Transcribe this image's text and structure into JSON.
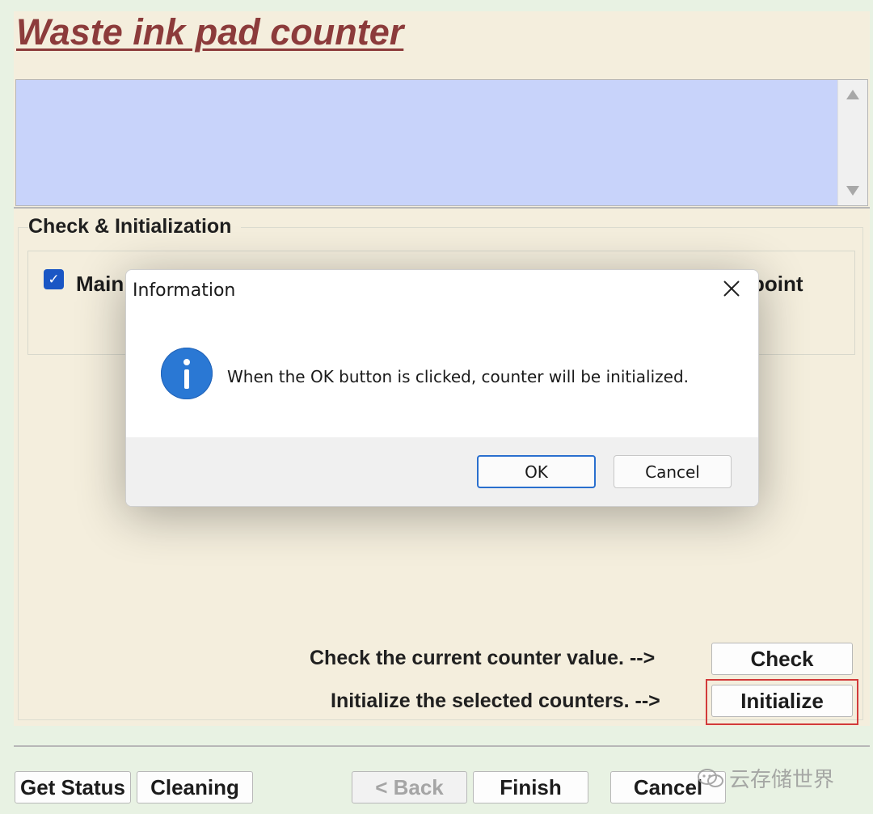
{
  "page": {
    "title": "Waste ink pad counter"
  },
  "group": {
    "label": "Check & Initialization",
    "option_label": "Main",
    "option_checked": true,
    "option_right_label": "point"
  },
  "actions": {
    "check_text": "Check the current counter value. -->",
    "check_button": "Check",
    "init_text": "Initialize the selected counters. -->",
    "init_button": "Initialize"
  },
  "nav": {
    "get_status": "Get Status",
    "cleaning": "Cleaning",
    "back": "< Back",
    "finish": "Finish",
    "cancel": "Cancel"
  },
  "dialog": {
    "title": "Information",
    "message": "When the OK button is clicked, counter will be initialized.",
    "ok": "OK",
    "cancel": "Cancel",
    "icon": "info-icon"
  },
  "watermark": {
    "text": "云存储世界"
  },
  "colors": {
    "title": "#8c3b3b",
    "display_bg": "#c8d3fa",
    "panel_bg": "#f4eedd",
    "highlight": "#d23a3a",
    "info_icon": "#2a78d4"
  }
}
